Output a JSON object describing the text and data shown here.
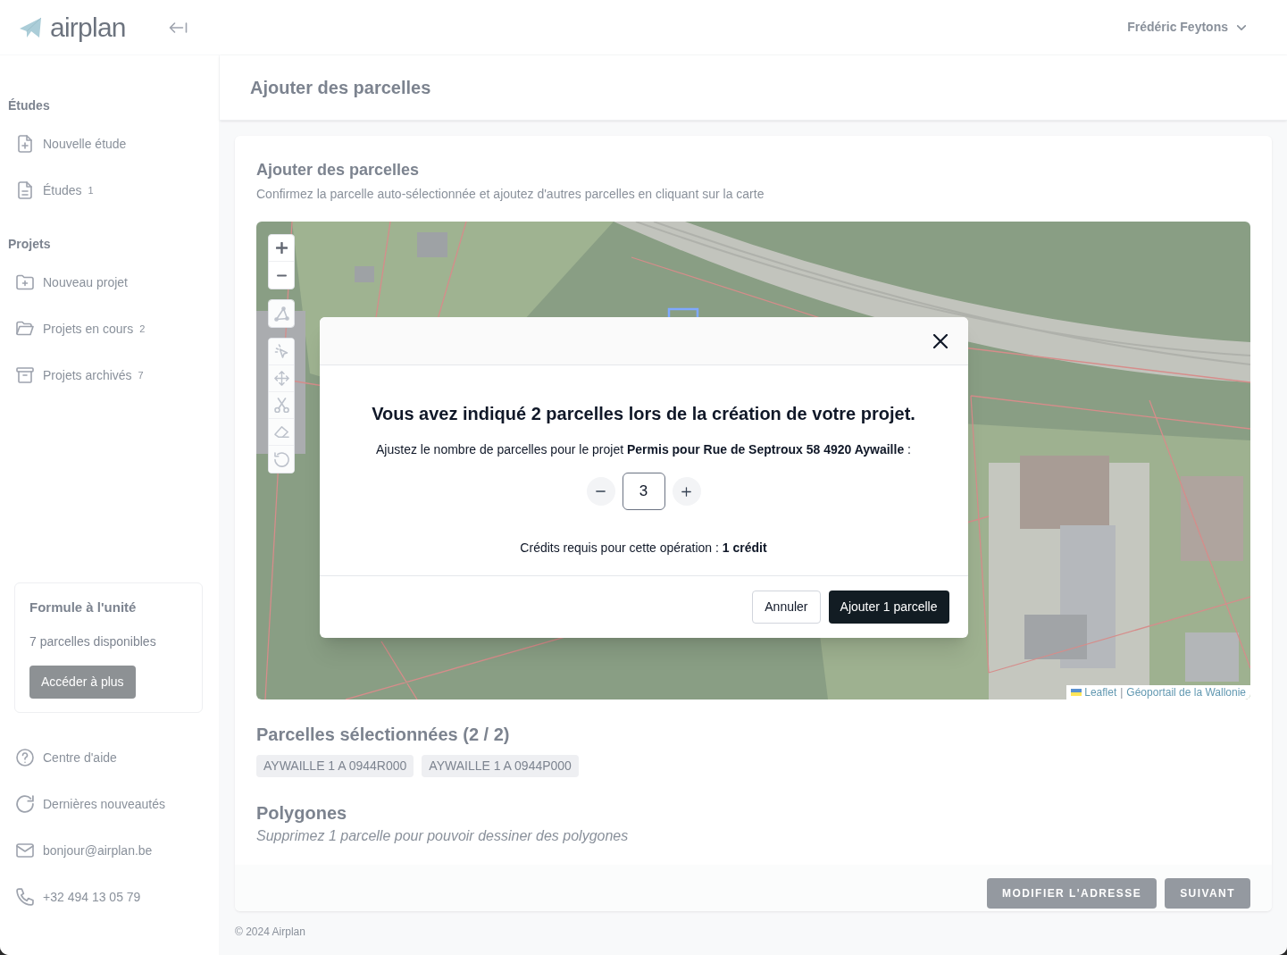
{
  "header": {
    "logo": "airplan",
    "user_name": "Frédéric Feytons"
  },
  "sidebar": {
    "sections": [
      {
        "title": "Études",
        "items": [
          {
            "label": "Nouvelle étude"
          },
          {
            "label": "Études",
            "count": "1"
          }
        ]
      },
      {
        "title": "Projets",
        "items": [
          {
            "label": "Nouveau projet"
          },
          {
            "label": "Projets en cours",
            "count": "2"
          },
          {
            "label": "Projets archivés",
            "count": "7"
          }
        ]
      }
    ],
    "plan_card": {
      "title": "Formule à l'unité",
      "text": "7 parcelles disponibles",
      "button": "Accéder à plus"
    },
    "links": [
      "Centre d'aide",
      "Dernières nouveautés",
      "bonjour@airplan.be",
      "+32 494 13 05 79"
    ]
  },
  "page": {
    "title": "Ajouter des parcelles",
    "card": {
      "title": "Ajouter des parcelles",
      "subtitle": "Confirmez la parcelle auto-sélectionnée et ajoutez d'autres parcelles en cliquant sur la carte",
      "map": {
        "draw_tools": [
          {
            "disabled": true
          },
          {
            "disabled": true
          },
          {
            "disabled": true
          },
          {
            "disabled": true
          },
          {
            "disabled": true
          },
          {
            "disabled": true
          }
        ],
        "attribution": {
          "links": [
            "Leaflet",
            "Géoportail de la Wallonie"
          ],
          "separator": "|"
        }
      },
      "selected_parcels": {
        "title": "Parcelles sélectionnées (2 / 2)",
        "chips": [
          "AYWAILLE 1 A 0944R000",
          "AYWAILLE 1 A 0944P000"
        ]
      },
      "polygons": {
        "title": "Polygones",
        "note": "Supprimez 1 parcelle pour pouvoir dessiner des polygones"
      },
      "buttons": [
        "MODIFIER L'ADRESSE",
        "SUIVANT"
      ]
    },
    "footer": "© 2024 Airplan"
  },
  "modal": {
    "heading": "Vous avez indiqué 2 parcelles lors de la création de votre projet.",
    "prompt": "Ajustez le nombre de parcelles pour le projet **Permis pour Rue de Septroux 58 4920 Aywaille** :",
    "stepper": {
      "value": "3"
    },
    "credits": "Crédits requis pour cette opération : **1 crédit**",
    "buttons": [
      {
        "label": "Annuler",
        "kind": "secondary"
      },
      {
        "label": "Ajouter 1 parcelle",
        "kind": "primary"
      }
    ]
  }
}
